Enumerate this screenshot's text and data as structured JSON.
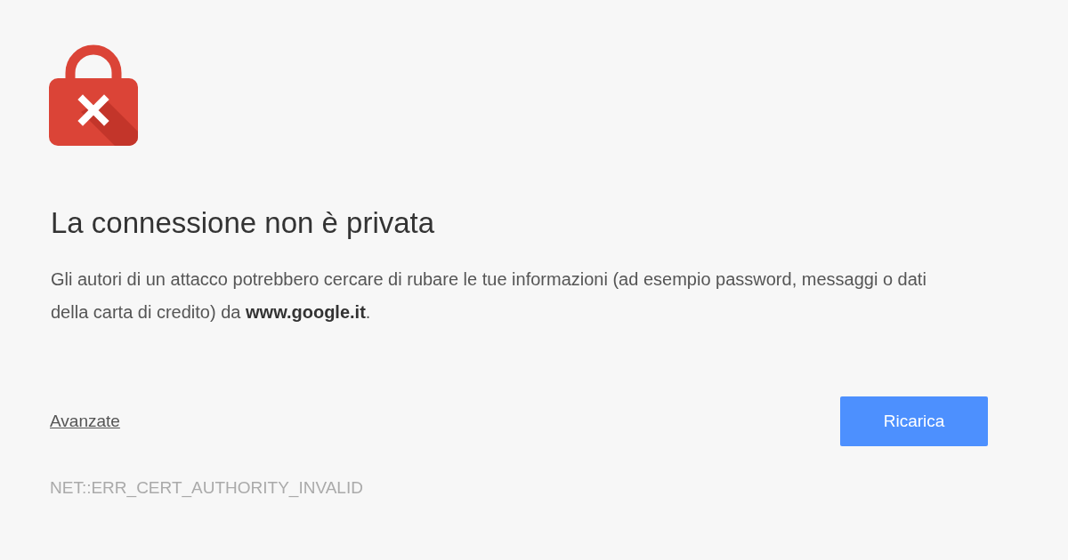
{
  "heading": "La connessione non è privata",
  "message": "Gli autori di un attacco potrebbero cercare di rubare le tue informazioni (ad esempio password, messaggi o dati della carta di credito) da **www.google.it**.",
  "advanced_link": "Avanzate",
  "reload_button": "Ricarica",
  "error_code": "NET::ERR_CERT_AUTHORITY_INVALID"
}
